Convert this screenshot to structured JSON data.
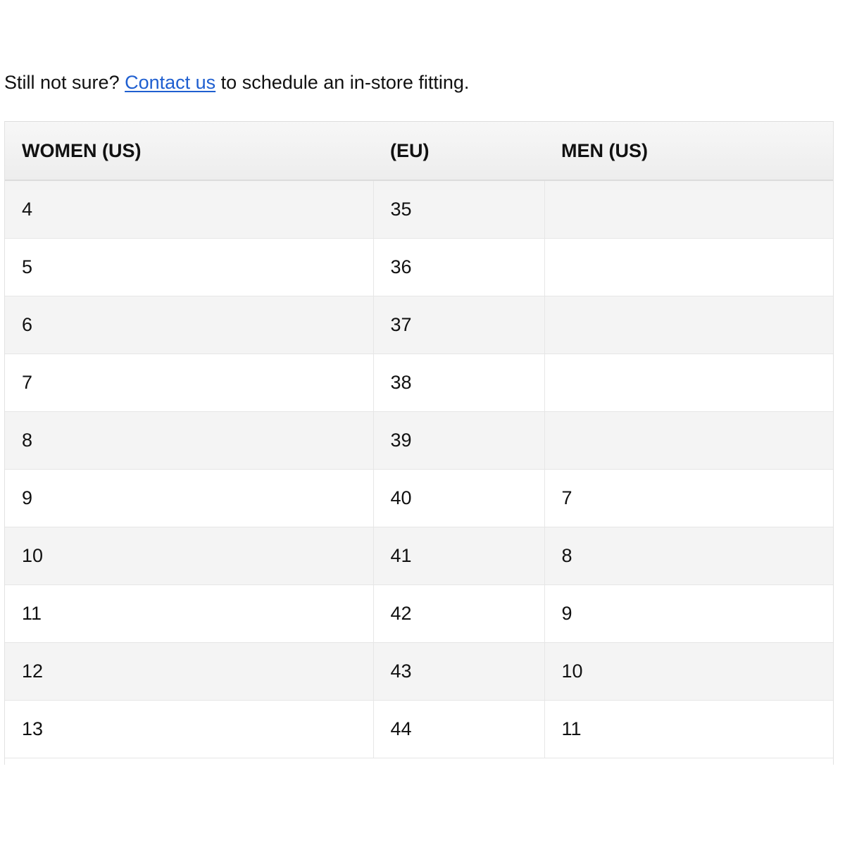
{
  "intro": {
    "before_link": "Still not sure? ",
    "link_text": "Contact us",
    "after_link": " to schedule an in-store fitting.",
    "link_color": "#1f5fd0"
  },
  "size_table": {
    "headers": [
      "WOMEN (US)",
      "(EU)",
      "MEN (US)"
    ],
    "rows": [
      [
        "4",
        "35",
        ""
      ],
      [
        "5",
        "36",
        ""
      ],
      [
        "6",
        "37",
        ""
      ],
      [
        "7",
        "38",
        ""
      ],
      [
        "8",
        "39",
        ""
      ],
      [
        "9",
        "40",
        "7"
      ],
      [
        "10",
        "41",
        "8"
      ],
      [
        "11",
        "42",
        "9"
      ],
      [
        "12",
        "43",
        "10"
      ],
      [
        "13",
        "44",
        "11"
      ]
    ]
  }
}
